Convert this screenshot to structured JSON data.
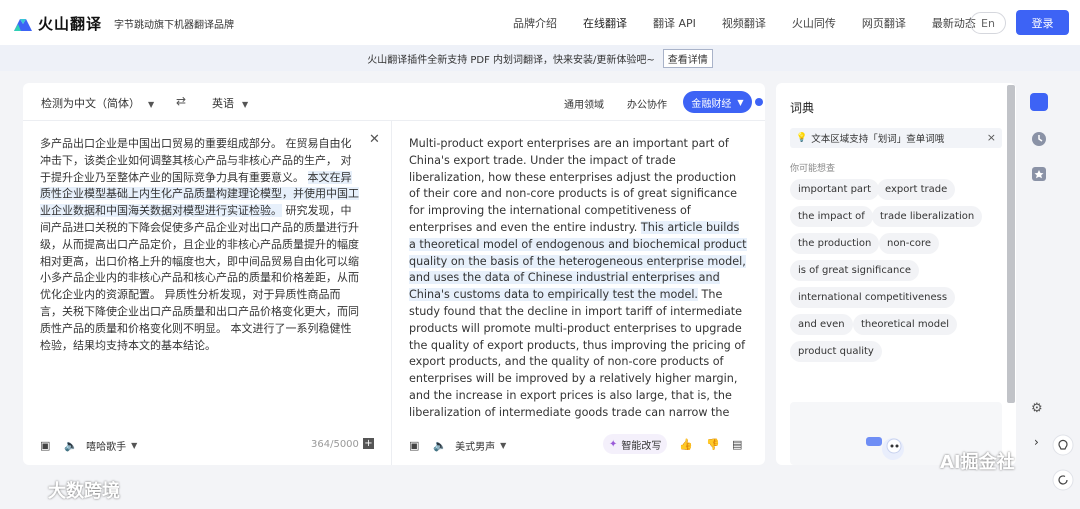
{
  "header": {
    "brand": "火山翻译",
    "slogan": "字节跳动旗下机器翻译品牌",
    "nav": [
      "品牌介绍",
      "在线翻译",
      "翻译 API",
      "视频翻译",
      "火山同传",
      "网页翻译",
      "最新动态"
    ],
    "lang_button": "En",
    "login_button": "登录",
    "accent": "#3d63f5"
  },
  "banner": {
    "text": "火山翻译插件全新支持 PDF 内划词翻译，快来安装/更新体验吧~",
    "button": "查看详情"
  },
  "translator": {
    "source_lang": "检测为中文（简体）",
    "swap_icon": "swap-icon",
    "target_lang": "英语",
    "domains": [
      "通用领域",
      "办公协作"
    ],
    "active_domain": "金融财经",
    "source_text_a": "多产品出口企业是中国出口贸易的重要组成部分。 在贸易自由化冲击下，该类企业如何调整其核心产品与非核心产品的生产， 对于提升企业乃至整体产业的国际竞争力具有重要意义。 ",
    "source_text_hl": "本文在异质性企业模型基础上内生化产品质量构建理论模型，并使用中国工业企业数据和中国海关数据对模型进行实证检验。",
    "source_text_b": " 研究发现，中间产品进口关税的下降会促使多产品企业对出口产品的质量进行升级，从而提高出口产品定价，且企业的非核心产品质量提升的幅度相对更高，出口价格上升的幅度也大，即中间品贸易自由化可以缩小多产品企业内的非核心产品和核心产品的质量和价格差距，从而优化企业内的资源配置。 异质性分析发现，对于异质性商品而言，关税下降使企业出口产品质量和出口产品价格变化更大，而同质性产品的质量和价格变化则不明显。 本文进行了一系列稳健性检验，结果均支持本文的基本结论。",
    "target_text_a": "Multi-product export enterprises are an important part of China's export trade. Under the impact of trade liberalization, how these enterprises adjust the production of their core and non-core products is of great significance for improving the international competitiveness of enterprises and even the entire industry. ",
    "target_text_hl": "This article builds a theoretical model of endogenous and biochemical product quality on the basis of the heterogeneous enterprise model, and uses the data of Chinese industrial enterprises and China's customs data to empirically test the model.",
    "target_text_b": " The study found that the decline in import tariff of intermediate products will promote multi-product enterprises to upgrade the quality of export products, thus improving the pricing of export products, and the quality of non-core products of enterprises will be improved by a relatively higher margin, and the increase in export prices is also large, that is, the liberalization of intermediate goods trade can narrow the",
    "source_voice": "嘻哈歌手",
    "char_count": "364/5000",
    "target_voice": "美式男声",
    "smart_rewrite": "智能改写"
  },
  "dictionary": {
    "title": "词典",
    "tip": "文本区域支持「划词」查单词哦",
    "maybe_label": "你可能想查",
    "chips": [
      "important part",
      "export trade",
      "the impact of",
      "trade liberalization",
      "the production",
      "non-core",
      "is of great significance",
      "international competitiveness",
      "and even",
      "theoretical model",
      "product quality"
    ]
  },
  "watermarks": [
    "大数跨境",
    "AI掘金社"
  ]
}
